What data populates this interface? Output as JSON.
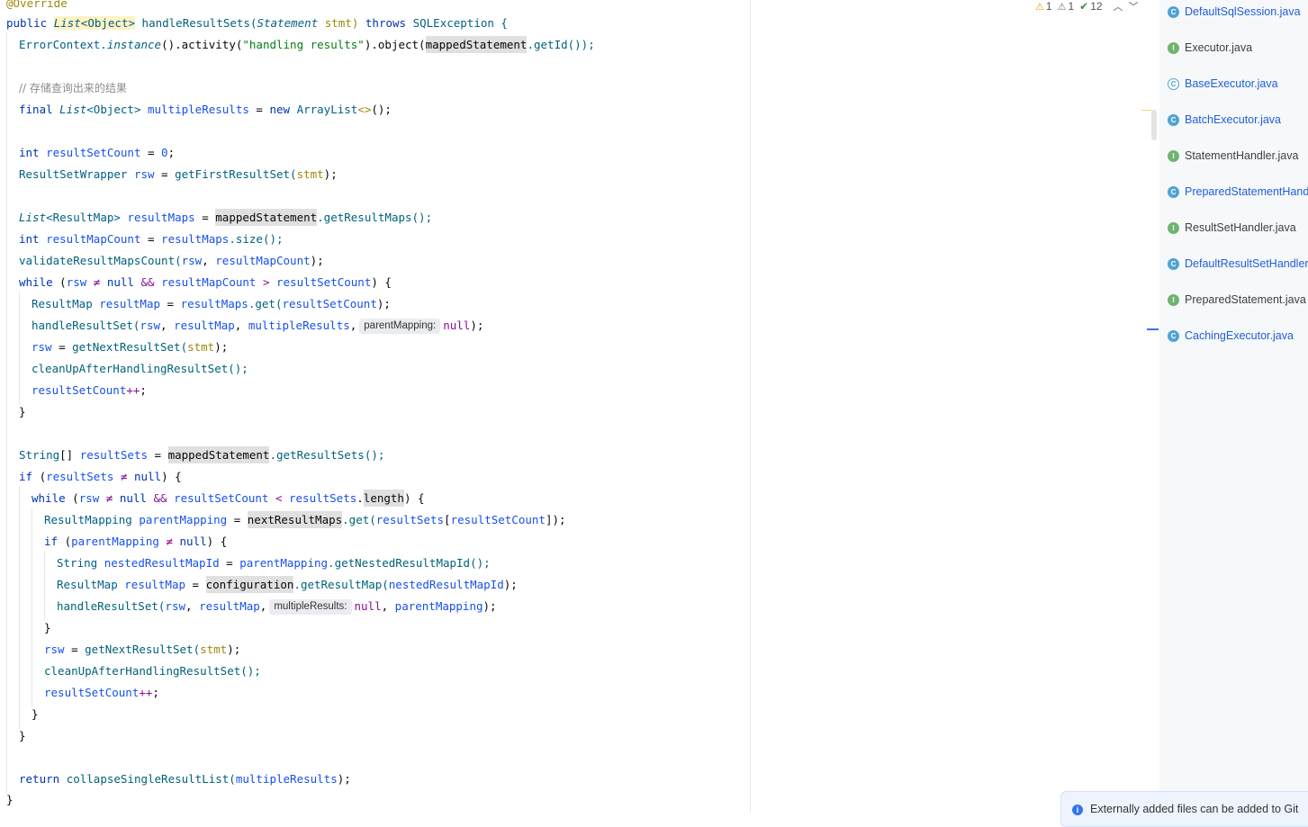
{
  "editor": {
    "hints": {
      "parent_mapping": "parentMapping:",
      "multiple_results": "multipleResults:"
    },
    "comment_storage": "// 存储查询出来的结果",
    "lines": {
      "l0": "@Override",
      "l1a": "public ",
      "l1b": "List",
      "l1c": "<Object>",
      "l1d": " handleResultSets(",
      "l1e": "Statement",
      "l1f": " stmt) ",
      "l1g": "throws",
      "l1h": " SQLException {",
      "l2a": "ErrorContext.",
      "l2b": "instance",
      "l2c": "().activity(",
      "l2d": "\"handling results\"",
      "l2e": ").object(",
      "l2f": "mappedStatement",
      "l2g": ".getId());",
      "l5a": "final ",
      "l5b": "List",
      "l5c": "<Object> ",
      "l5d": "multipleResults",
      "l5e": " = ",
      "l5f": "new ",
      "l5g": "ArrayList",
      "l5h": "<>",
      "l5i": "();",
      "l7a": "int ",
      "l7b": "resultSetCount",
      "l7c": " = ",
      "l7d": "0",
      "l7e": ";",
      "l8a": "ResultSetWrapper ",
      "l8b": "rsw",
      "l8c": " = ",
      "l8d": "getFirstResultSet(",
      "l8e": "stmt",
      "l8f": ");",
      "l10a": "List",
      "l10b": "<ResultMap> ",
      "l10c": "resultMaps",
      "l10d": " = ",
      "l10e": "mappedStatement",
      "l10f": ".getResultMaps();",
      "l11a": "int ",
      "l11b": "resultMapCount",
      "l11c": " = ",
      "l11d": "resultMaps",
      "l11e": ".size();",
      "l12a": "validateResultMapsCount(",
      "l12b": "rsw",
      "l12c": ", ",
      "l12d": "resultMapCount",
      "l12e": ");",
      "l13a": "while ",
      "l13b": "(",
      "l13c": "rsw",
      "l13d": " ≠ ",
      "l13e": "null",
      "l13f": " && ",
      "l13g": "resultMapCount",
      "l13h": " > ",
      "l13i": "resultSetCount",
      "l13j": ") {",
      "l14a": "ResultMap ",
      "l14b": "resultMap",
      "l14c": " = ",
      "l14d": "resultMaps",
      "l14e": ".get(",
      "l14f": "resultSetCount",
      "l14g": ");",
      "l15a": "handleResultSet(",
      "l15b": "rsw",
      "l15c": ", ",
      "l15d": "resultMap",
      "l15e": ", ",
      "l15f": "multipleResults",
      "l15g": ",",
      "l15h": "null",
      "l15i": ");",
      "l16a": "rsw",
      "l16b": " = ",
      "l16c": "getNextResultSet(",
      "l16d": "stmt",
      "l16e": ");",
      "l17a": "cleanUpAfterHandlingResultSet();",
      "l18a": "resultSetCount",
      "l18b": "++",
      "l18c": ";",
      "l19a": "}",
      "l21a": "String",
      "l21b": "[] ",
      "l21c": "resultSets",
      "l21d": " = ",
      "l21e": "mappedStatement",
      "l21f": ".getResultSets();",
      "l22a": "if ",
      "l22b": "(",
      "l22c": "resultSets",
      "l22d": " ≠ ",
      "l22e": "null",
      "l22f": ") {",
      "l23a": "while ",
      "l23b": "(",
      "l23c": "rsw",
      "l23d": " ≠ ",
      "l23e": "null",
      "l23f": " && ",
      "l23g": "resultSetCount",
      "l23h": " < ",
      "l23i": "resultSets",
      "l23j": ".",
      "l23k": "length",
      "l23l": ") {",
      "l24a": "ResultMapping ",
      "l24b": "parentMapping",
      "l24c": " = ",
      "l24d": "nextResultMaps",
      "l24e": ".get(",
      "l24f": "resultSets",
      "l24g": "[",
      "l24h": "resultSetCount",
      "l24i": "]);",
      "l25a": "if ",
      "l25b": "(",
      "l25c": "parentMapping",
      "l25d": " ≠ ",
      "l25e": "null",
      "l25f": ") {",
      "l26a": "String ",
      "l26b": "nestedResultMapId",
      "l26c": " = ",
      "l26d": "parentMapping",
      "l26e": ".getNestedResultMapId();",
      "l27a": "ResultMap ",
      "l27b": "resultMap",
      "l27c": " = ",
      "l27d": "configuration",
      "l27e": ".getResultMap(",
      "l27f": "nestedResultMapId",
      "l27g": ");",
      "l28a": "handleResultSet(",
      "l28b": "rsw",
      "l28c": ", ",
      "l28d": "resultMap",
      "l28e": ",",
      "l28f": "null",
      "l28g": ", ",
      "l28h": "parentMapping",
      "l28i": ");",
      "l29a": "}",
      "l30a": "rsw",
      "l30b": " = ",
      "l30c": "getNextResultSet(",
      "l30d": "stmt",
      "l30e": ");",
      "l31a": "cleanUpAfterHandlingResultSet();",
      "l32a": "resultSetCount",
      "l32b": "++",
      "l32c": ";",
      "l33a": "}",
      "l34a": "}",
      "l36a": "return ",
      "l36b": "collapseSingleResultList(",
      "l36c": "multipleResults",
      "l36d": ");",
      "l37a": "}"
    }
  },
  "inspections": {
    "warnings": "1",
    "weak_warnings": "1",
    "typos": "12"
  },
  "files": [
    {
      "name": "DefaultSqlSession.java",
      "kind": "C",
      "style": "blue"
    },
    {
      "name": "Executor.java",
      "kind": "I",
      "style": "plain"
    },
    {
      "name": "BaseExecutor.java",
      "kind": "C",
      "style": "blue"
    },
    {
      "name": "BatchExecutor.java",
      "kind": "C",
      "style": "blue"
    },
    {
      "name": "StatementHandler.java",
      "kind": "I",
      "style": "plain"
    },
    {
      "name": "PreparedStatementHandler.java",
      "kind": "C",
      "style": "blue"
    },
    {
      "name": "ResultSetHandler.java",
      "kind": "I",
      "style": "plain"
    },
    {
      "name": "DefaultResultSetHandler.java",
      "kind": "C",
      "style": "blue"
    },
    {
      "name": "PreparedStatement.java",
      "kind": "I",
      "style": "plain"
    },
    {
      "name": "CachingExecutor.java",
      "kind": "C",
      "style": "blue"
    }
  ],
  "notification": {
    "text": "Externally added files can be added to Git"
  },
  "colors": {
    "keyword": "#0033b3",
    "method": "#00627a",
    "field": "#871094",
    "string": "#067d17",
    "file_link": "#1e5fd8"
  }
}
